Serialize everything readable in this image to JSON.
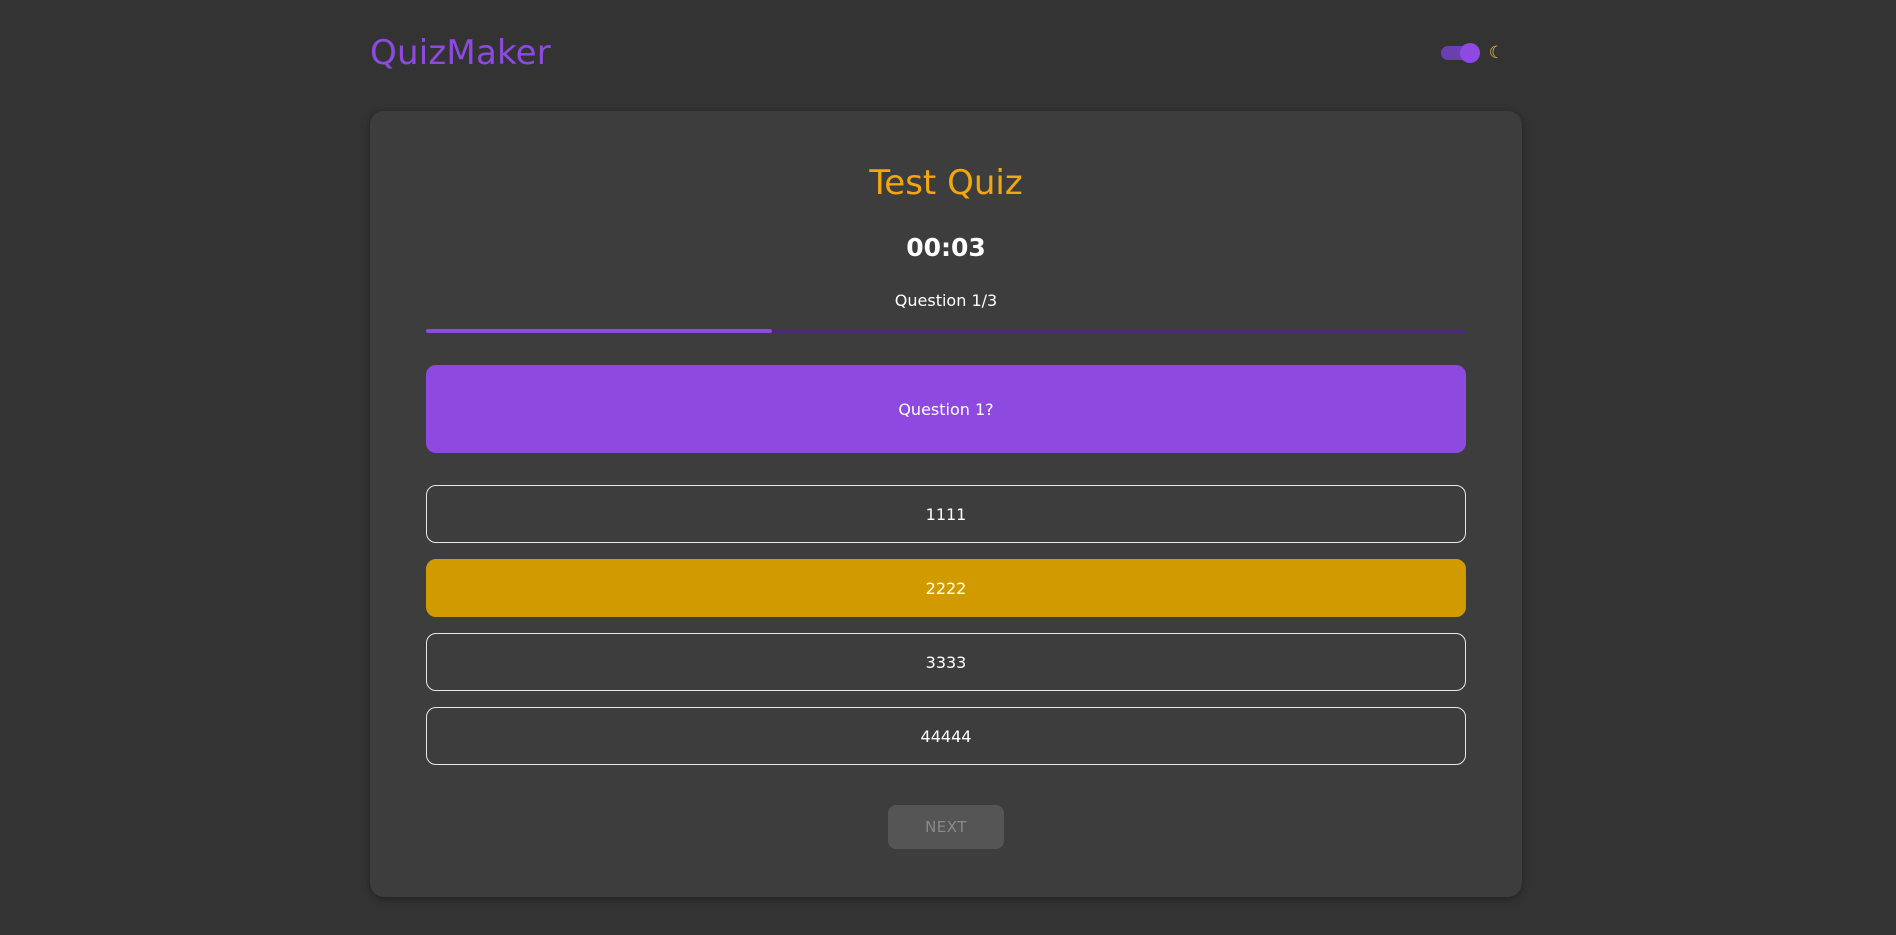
{
  "header": {
    "logo": "QuizMaker",
    "theme_icon": "moon-icon",
    "dark_mode_on": true
  },
  "quiz": {
    "title": "Test Quiz",
    "timer": "00:03",
    "question_counter": "Question 1/3",
    "progress_fraction": 0.333,
    "question_text": "Question 1?",
    "answers": [
      {
        "label": "1111",
        "selected": false
      },
      {
        "label": "2222",
        "selected": true
      },
      {
        "label": "3333",
        "selected": false
      },
      {
        "label": "44444",
        "selected": false
      }
    ],
    "next_label": "NEXT",
    "next_disabled": true
  },
  "colors": {
    "background": "#333333",
    "card": "#3d3d3d",
    "accent_purple": "#8e4ae0",
    "title_orange": "#f0a80e",
    "selected_answer": "#d19b00"
  }
}
